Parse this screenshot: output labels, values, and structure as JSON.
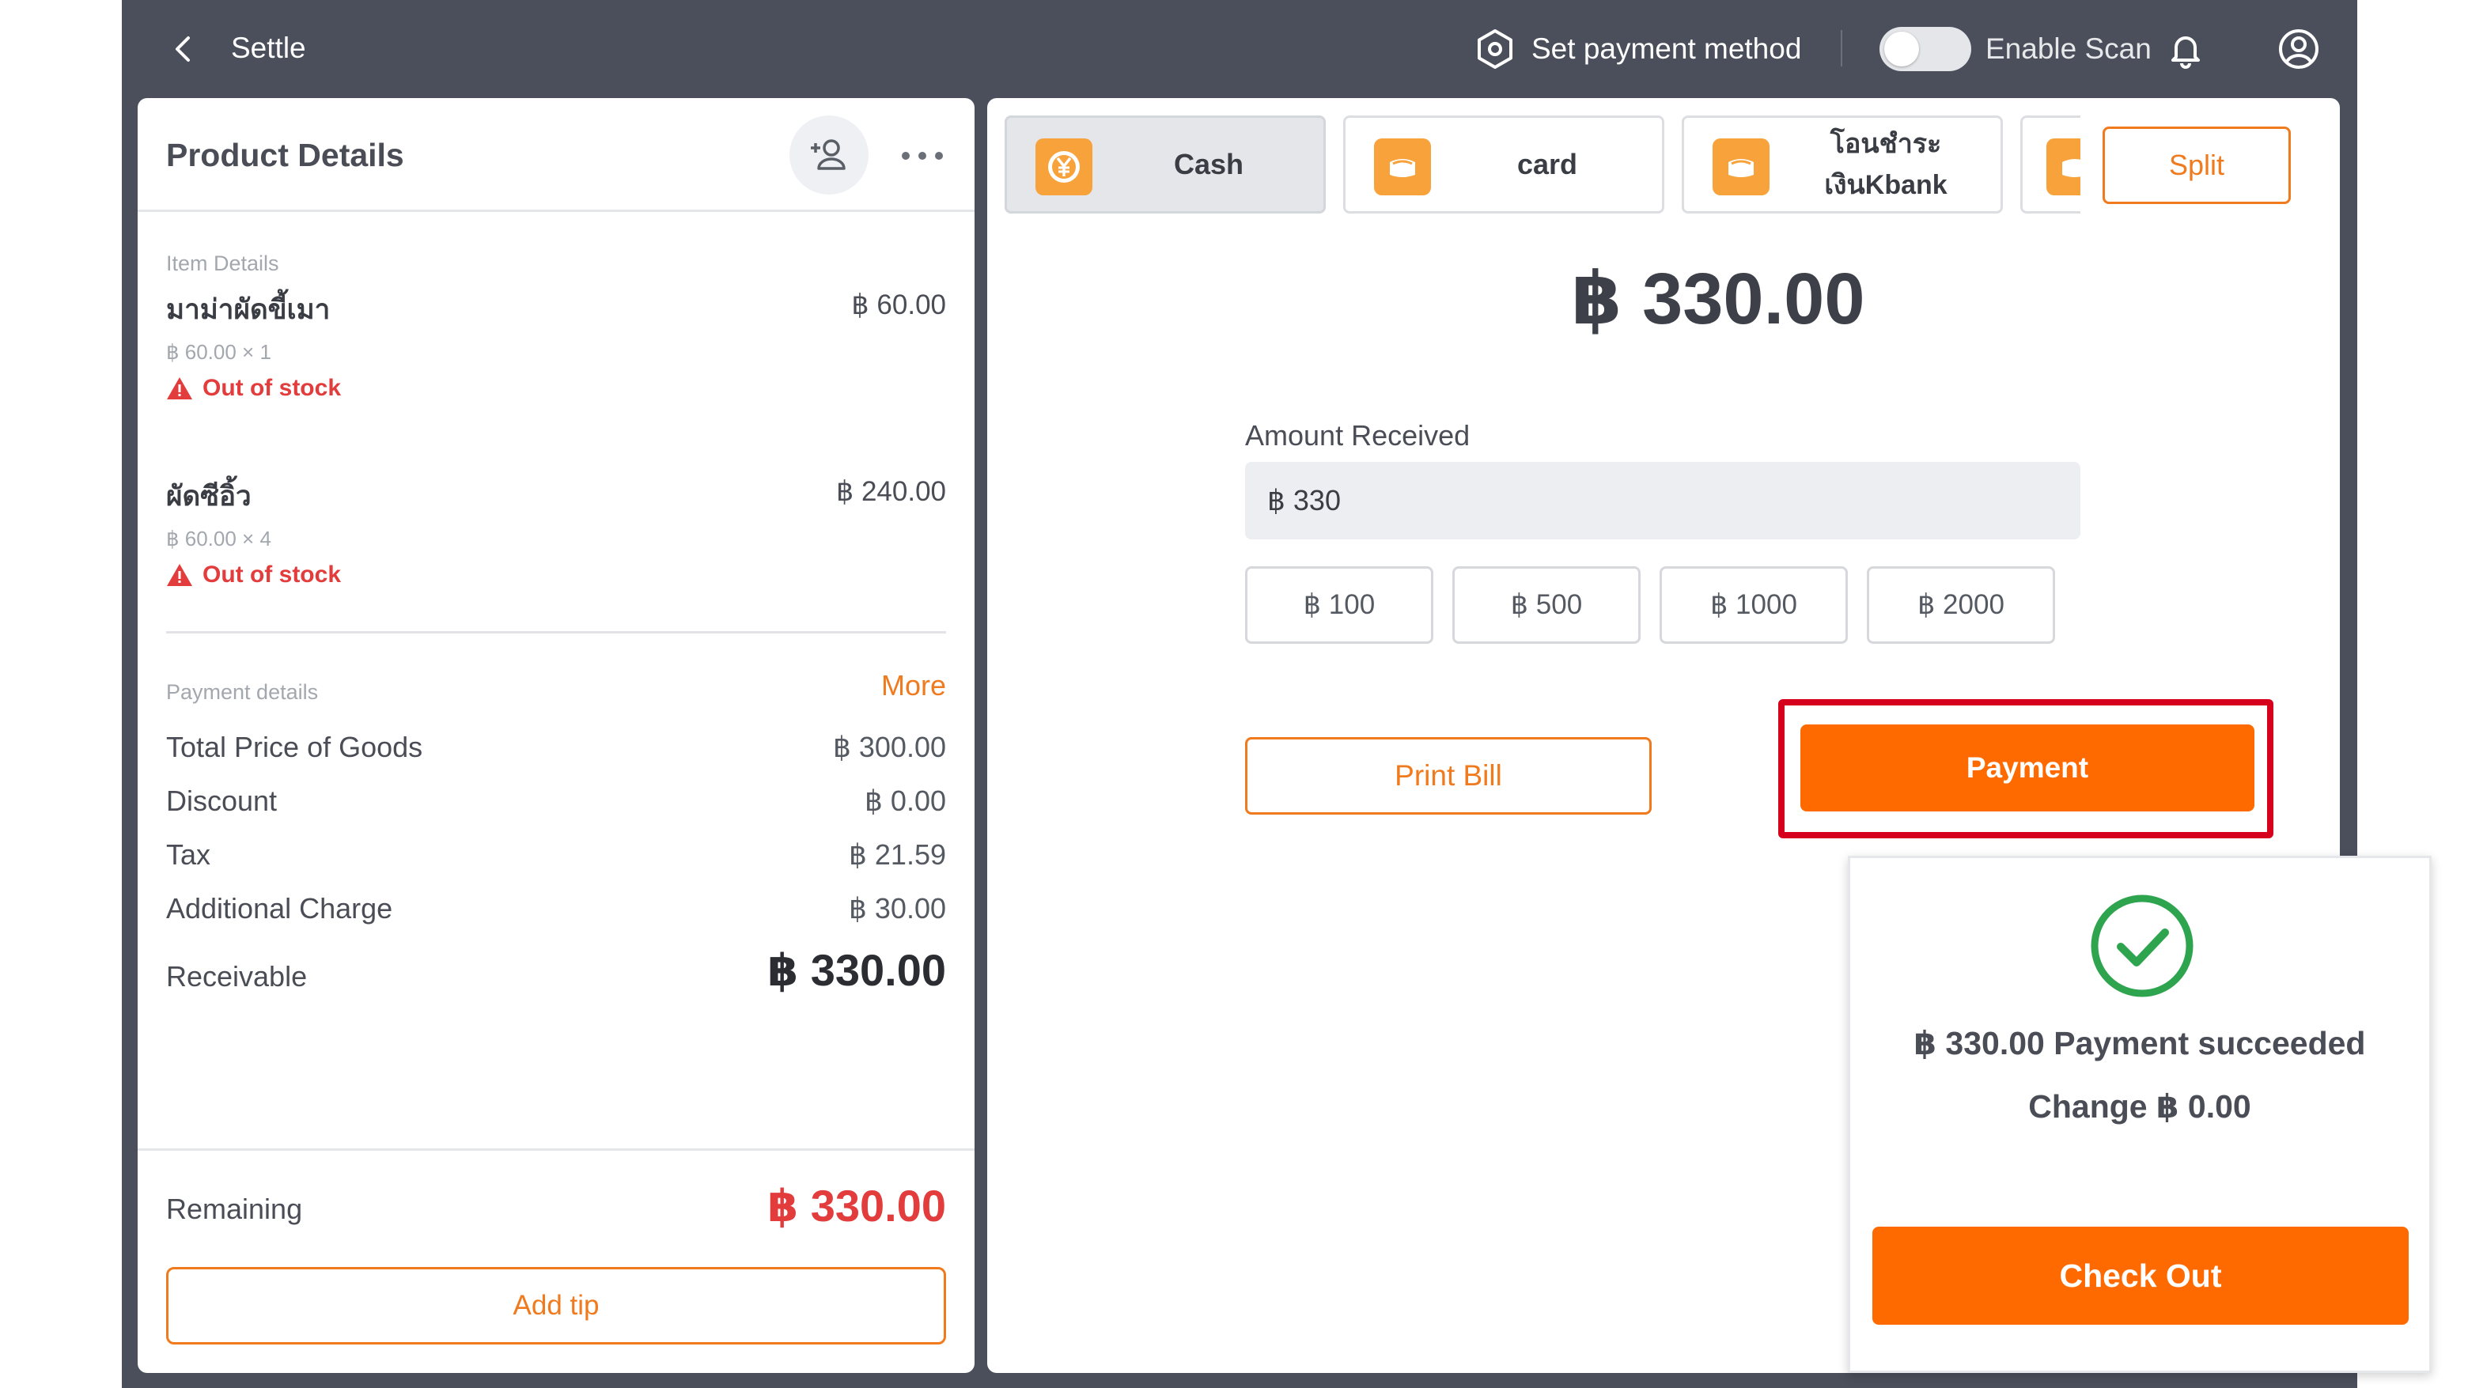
{
  "topbar": {
    "title": "Settle",
    "set_payment_method": "Set payment method",
    "enable_scan": "Enable Scan",
    "enable_scan_on": false
  },
  "left": {
    "title": "Product Details",
    "item_details_label": "Item Details",
    "items": [
      {
        "name": "มาม่าผัดขี้เมา",
        "price": "฿ 60.00",
        "qty": "฿ 60.00 × 1",
        "status": "Out of stock"
      },
      {
        "name": "ผัดซีอิ้ว",
        "price": "฿ 240.00",
        "qty": "฿ 60.00 × 4",
        "status": "Out of stock"
      }
    ],
    "payment_details_label": "Payment details",
    "more": "More",
    "rows": [
      {
        "label": "Total Price of Goods",
        "value": "฿ 300.00"
      },
      {
        "label": "Discount",
        "value": "฿ 0.00"
      },
      {
        "label": "Tax",
        "value": "฿ 21.59"
      },
      {
        "label": "Additional Charge",
        "value": "฿ 30.00"
      }
    ],
    "receivable_label": "Receivable",
    "receivable_value": "฿ 330.00",
    "remaining_label": "Remaining",
    "remaining_value": "฿ 330.00",
    "add_tip": "Add tip"
  },
  "right": {
    "tabs": [
      {
        "label": "Cash",
        "icon": "yen-coin-icon"
      },
      {
        "label": "card",
        "icon": "wallet-icon"
      },
      {
        "label": "โอนชำระ เงินKbank",
        "icon": "wallet-icon"
      },
      {
        "label": "",
        "icon": "wallet-icon"
      }
    ],
    "split": "Split",
    "amount": "฿ 330.00",
    "amount_received_label": "Amount Received",
    "amount_received_value": "฿  330",
    "quick_amounts": [
      "฿ 100",
      "฿ 500",
      "฿ 1000",
      "฿ 2000"
    ],
    "print_bill": "Print Bill",
    "payment": "Payment"
  },
  "popup": {
    "line1": "฿ 330.00 Payment succeeded",
    "line2": "Change ฿ 0.00",
    "checkout": "Check Out"
  },
  "colors": {
    "accent": "#ff6a00",
    "accent_outline": "#f07a1e",
    "error": "#e23c3c",
    "success": "#2ea44f",
    "highlight": "#d6001c",
    "frame": "#4a4f5b"
  }
}
